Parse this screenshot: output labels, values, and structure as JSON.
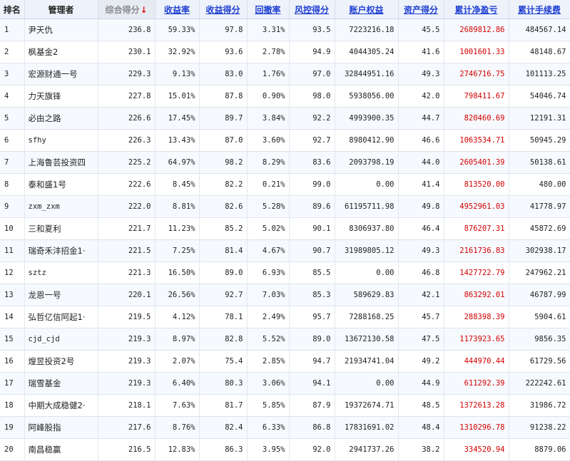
{
  "headers": {
    "rank": "排名",
    "manager": "管理者",
    "score": "综合得分",
    "sort_arrow": "↓",
    "return_rate": "收益率",
    "return_score": "收益得分",
    "drawdown": "回撤率",
    "risk_score": "风控得分",
    "equity": "账户权益",
    "asset_score": "资产得分",
    "cum_pnl": "累计净盈亏",
    "cum_fee": "累计手续费"
  },
  "rows": [
    {
      "rank": "1",
      "manager": "尹天仇",
      "score": "236.8",
      "return_rate": "59.33%",
      "return_score": "97.8",
      "drawdown": "3.31%",
      "risk_score": "93.5",
      "equity": "7223216.18",
      "asset_score": "45.5",
      "cum_pnl": "2689812.86",
      "cum_fee": "484567.14"
    },
    {
      "rank": "2",
      "manager": "枫基金2",
      "score": "230.1",
      "return_rate": "32.92%",
      "return_score": "93.6",
      "drawdown": "2.78%",
      "risk_score": "94.9",
      "equity": "4044305.24",
      "asset_score": "41.6",
      "cum_pnl": "1001601.33",
      "cum_fee": "48148.67"
    },
    {
      "rank": "3",
      "manager": "宏源财通一号",
      "score": "229.3",
      "return_rate": "9.13%",
      "return_score": "83.0",
      "drawdown": "1.76%",
      "risk_score": "97.0",
      "equity": "32844951.16",
      "asset_score": "49.3",
      "cum_pnl": "2746716.75",
      "cum_fee": "101113.25"
    },
    {
      "rank": "4",
      "manager": "力天旗锋",
      "score": "227.8",
      "return_rate": "15.01%",
      "return_score": "87.8",
      "drawdown": "0.90%",
      "risk_score": "98.0",
      "equity": "5938056.00",
      "asset_score": "42.0",
      "cum_pnl": "798411.67",
      "cum_fee": "54046.74"
    },
    {
      "rank": "5",
      "manager": "必由之路",
      "score": "226.6",
      "return_rate": "17.45%",
      "return_score": "89.7",
      "drawdown": "3.84%",
      "risk_score": "92.2",
      "equity": "4993900.35",
      "asset_score": "44.7",
      "cum_pnl": "820460.69",
      "cum_fee": "12191.31"
    },
    {
      "rank": "6",
      "manager": "sfhy",
      "score": "226.3",
      "return_rate": "13.43%",
      "return_score": "87.0",
      "drawdown": "3.60%",
      "risk_score": "92.7",
      "equity": "8980412.90",
      "asset_score": "46.6",
      "cum_pnl": "1063534.71",
      "cum_fee": "50945.29"
    },
    {
      "rank": "7",
      "manager": "上海鲁芸投资四",
      "score": "225.2",
      "return_rate": "64.97%",
      "return_score": "98.2",
      "drawdown": "8.29%",
      "risk_score": "83.6",
      "equity": "2093798.19",
      "asset_score": "44.0",
      "cum_pnl": "2605401.39",
      "cum_fee": "50138.61"
    },
    {
      "rank": "8",
      "manager": "泰和盛1号",
      "score": "222.6",
      "return_rate": "8.45%",
      "return_score": "82.2",
      "drawdown": "0.21%",
      "risk_score": "99.0",
      "equity": "0.00",
      "asset_score": "41.4",
      "cum_pnl": "813520.00",
      "cum_fee": "480.00"
    },
    {
      "rank": "9",
      "manager": "zxm_zxm",
      "score": "222.0",
      "return_rate": "8.81%",
      "return_score": "82.6",
      "drawdown": "5.28%",
      "risk_score": "89.6",
      "equity": "61195711.98",
      "asset_score": "49.8",
      "cum_pnl": "4952961.03",
      "cum_fee": "41778.97"
    },
    {
      "rank": "10",
      "manager": "三和夏利",
      "score": "221.7",
      "return_rate": "11.23%",
      "return_score": "85.2",
      "drawdown": "5.02%",
      "risk_score": "90.1",
      "equity": "8306937.80",
      "asset_score": "46.4",
      "cum_pnl": "876207.31",
      "cum_fee": "45872.69"
    },
    {
      "rank": "11",
      "manager": "瑞奇禾沣招金1·",
      "score": "221.5",
      "return_rate": "7.25%",
      "return_score": "81.4",
      "drawdown": "4.67%",
      "risk_score": "90.7",
      "equity": "31989805.12",
      "asset_score": "49.3",
      "cum_pnl": "2161736.83",
      "cum_fee": "302938.17"
    },
    {
      "rank": "12",
      "manager": "sztz",
      "score": "221.3",
      "return_rate": "16.50%",
      "return_score": "89.0",
      "drawdown": "6.93%",
      "risk_score": "85.5",
      "equity": "0.00",
      "asset_score": "46.8",
      "cum_pnl": "1427722.79",
      "cum_fee": "247962.21"
    },
    {
      "rank": "13",
      "manager": "龙恩一号",
      "score": "220.1",
      "return_rate": "26.56%",
      "return_score": "92.7",
      "drawdown": "7.03%",
      "risk_score": "85.3",
      "equity": "589629.83",
      "asset_score": "42.1",
      "cum_pnl": "863292.01",
      "cum_fee": "46787.99"
    },
    {
      "rank": "14",
      "manager": "弘哲亿信阿起1·",
      "score": "219.5",
      "return_rate": "4.12%",
      "return_score": "78.1",
      "drawdown": "2.49%",
      "risk_score": "95.7",
      "equity": "7288168.25",
      "asset_score": "45.7",
      "cum_pnl": "288398.39",
      "cum_fee": "5904.61"
    },
    {
      "rank": "15",
      "manager": "cjd_cjd",
      "score": "219.3",
      "return_rate": "8.97%",
      "return_score": "82.8",
      "drawdown": "5.52%",
      "risk_score": "89.0",
      "equity": "13672130.58",
      "asset_score": "47.5",
      "cum_pnl": "1173923.65",
      "cum_fee": "9856.35"
    },
    {
      "rank": "16",
      "manager": "煌昱投资2号",
      "score": "219.3",
      "return_rate": "2.07%",
      "return_score": "75.4",
      "drawdown": "2.85%",
      "risk_score": "94.7",
      "equity": "21934741.04",
      "asset_score": "49.2",
      "cum_pnl": "444970.44",
      "cum_fee": "61729.56"
    },
    {
      "rank": "17",
      "manager": "瑞雪基金",
      "score": "219.3",
      "return_rate": "6.40%",
      "return_score": "80.3",
      "drawdown": "3.06%",
      "risk_score": "94.1",
      "equity": "0.00",
      "asset_score": "44.9",
      "cum_pnl": "611292.39",
      "cum_fee": "222242.61"
    },
    {
      "rank": "18",
      "manager": "中期大成稳健2·",
      "score": "218.1",
      "return_rate": "7.63%",
      "return_score": "81.7",
      "drawdown": "5.85%",
      "risk_score": "87.9",
      "equity": "19372674.71",
      "asset_score": "48.5",
      "cum_pnl": "1372613.28",
      "cum_fee": "31986.72"
    },
    {
      "rank": "19",
      "manager": "阿峰股指",
      "score": "217.6",
      "return_rate": "8.76%",
      "return_score": "82.4",
      "drawdown": "6.33%",
      "risk_score": "86.8",
      "equity": "17831691.02",
      "asset_score": "48.4",
      "cum_pnl": "1310296.78",
      "cum_fee": "91238.22"
    },
    {
      "rank": "20",
      "manager": "南昌稳赢",
      "score": "216.5",
      "return_rate": "12.83%",
      "return_score": "86.3",
      "drawdown": "3.95%",
      "risk_score": "92.0",
      "equity": "2941737.26",
      "asset_score": "38.2",
      "cum_pnl": "334520.94",
      "cum_fee": "8879.06"
    }
  ],
  "colors": {
    "link": "#1f3fd1",
    "negative_red": "#d40000",
    "sort_arrow": "#e01010",
    "header_bg": "#eef3fb",
    "row_alt_bg": "#f6f9fd"
  }
}
